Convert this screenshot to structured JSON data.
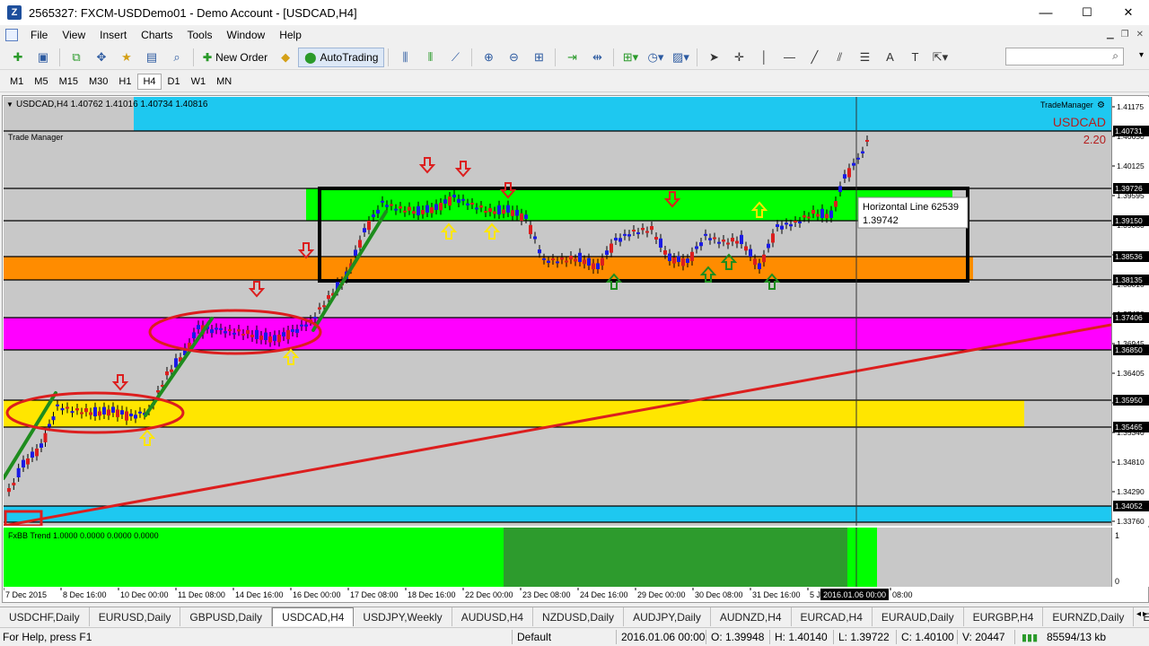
{
  "window": {
    "title": "2565327: FXCM-USDDemo01 - Demo Account - [USDCAD,H4]",
    "minimize": "—",
    "maximize": "☐",
    "close": "✕"
  },
  "menu": [
    "File",
    "View",
    "Insert",
    "Charts",
    "Tools",
    "Window",
    "Help"
  ],
  "toolbar": {
    "new_order": "New Order",
    "auto_trading": "AutoTrading"
  },
  "timeframes": [
    "M1",
    "M5",
    "M15",
    "M30",
    "H1",
    "H4",
    "D1",
    "W1",
    "MN"
  ],
  "active_timeframe": "H4",
  "chart": {
    "header": "USDCAD,H4  1.40762 1.41016 1.40734 1.40816",
    "trade_manager_label": "Trade Manager",
    "trade_manager_btn": "TradeManager",
    "symbol": "USDCAD",
    "spread": "2.20",
    "tooltip_name": "Horizontal Line 62539",
    "tooltip_value": "1.39742",
    "indicator_label": "FxBB Trend 1.0000 0.0000 0.0000 0.0000",
    "indicator_max": "1",
    "indicator_min": "0",
    "crosshair_time": "2016.01.06 00:00",
    "price_ticks": [
      "1.41175",
      "1.40650",
      "1.40125",
      "1.39595",
      "1.39060",
      "1.38535",
      "1.38010",
      "1.37480",
      "1.36945",
      "1.36405",
      "1.35875",
      "1.35340",
      "1.34810",
      "1.34290",
      "1.33760"
    ],
    "price_labels": [
      {
        "text": "1.40731",
        "color": "#000000"
      },
      {
        "text": "1.39726",
        "color": "#000000"
      },
      {
        "text": "1.39150",
        "color": "#000000"
      },
      {
        "text": "1.38536",
        "color": "#000000"
      },
      {
        "text": "1.38135",
        "color": "#000000"
      },
      {
        "text": "1.37406",
        "color": "#000000"
      },
      {
        "text": "1.36850",
        "color": "#000000"
      },
      {
        "text": "1.35950",
        "color": "#000000"
      },
      {
        "text": "1.35465",
        "color": "#000000"
      },
      {
        "text": "1.34052",
        "color": "#000000"
      }
    ],
    "time_labels": [
      "7 Dec 2015",
      "8 Dec 16:00",
      "10 Dec 00:00",
      "11 Dec 08:00",
      "14 Dec 16:00",
      "16 Dec 00:00",
      "17 Dec 08:00",
      "18 Dec 16:00",
      "22 Dec 00:00",
      "23 Dec 08:00",
      "24 Dec 16:00",
      "29 Dec 00:00",
      "30 Dec 08:00",
      "31 Dec 16:00",
      "5 Ja",
      "08:00"
    ]
  },
  "symbol_tabs": [
    "USDCHF,Daily",
    "EURUSD,Daily",
    "GBPUSD,Daily",
    "USDCAD,H4",
    "USDJPY,Weekly",
    "AUDUSD,H4",
    "NZDUSD,Daily",
    "AUDJPY,Daily",
    "AUDNZD,H4",
    "EURCAD,H4",
    "EURAUD,Daily",
    "EURGBP,H4",
    "EURNZD,Daily",
    "EUR"
  ],
  "active_symbol_tab": "USDCAD,H4",
  "status": {
    "help": "For Help, press F1",
    "profile": "Default",
    "datetime": "2016.01.06 00:00",
    "open": "O: 1.39948",
    "high": "H: 1.40140",
    "low": "L: 1.39722",
    "close": "C: 1.40100",
    "volume": "V: 20447",
    "traffic": "85594/13 kb"
  },
  "colors": {
    "chart_bg": "#c8c8c8",
    "bull_candle": "#1a1ae6",
    "bear_candle": "#dc1e1e",
    "zone_green": "#00ff00",
    "zone_orange": "#ff8c00",
    "zone_magenta": "#ff00ff",
    "zone_yellow": "#ffe600",
    "zone_cyan": "#1ec8f0",
    "trendline_red": "#dc1e1e",
    "trendline_green": "#1e8c1e",
    "ind_green": "#00ff00",
    "ind_dark_green": "#2d9b2d"
  }
}
